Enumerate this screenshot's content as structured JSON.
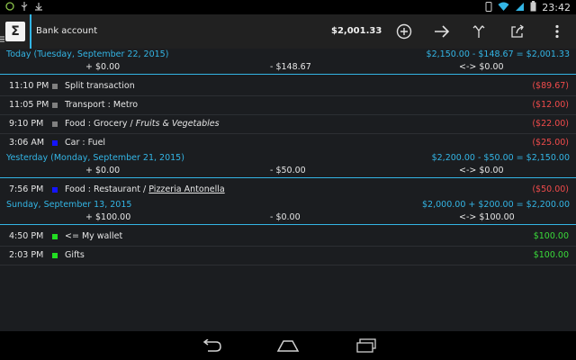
{
  "status_bar": {
    "time": "23:42",
    "left_icons": [
      "android-debug-icon",
      "usb-icon",
      "download-icon"
    ],
    "right_icons": [
      "vibrate-icon",
      "wifi-icon",
      "signal-icon",
      "battery-icon"
    ]
  },
  "action_bar": {
    "account_name": "Bank account",
    "balance": "$2,001.33",
    "actions": [
      "add-icon",
      "transfer-icon",
      "split-icon",
      "share-icon",
      "overflow-menu-icon"
    ],
    "accent_color": "#33b5e5"
  },
  "groups": [
    {
      "date": "Today (Tuesday, September 22, 2015)",
      "calc": "$2,150.00 - $148.67 = $2,001.33",
      "income": "+ $0.00",
      "expense": "- $148.67",
      "transfer": "<-> $0.00",
      "transactions": [
        {
          "time": "11:10 PM",
          "color": "#808080",
          "category": "Split transaction",
          "sub": "",
          "payee": "",
          "amount": "($89.67)",
          "amount_color": "#f24b4b"
        },
        {
          "time": "11:05 PM",
          "color": "#808080",
          "category": "Transport : Metro",
          "sub": "",
          "payee": "",
          "amount": "($12.00)",
          "amount_color": "#f24b4b"
        },
        {
          "time": "9:10 PM",
          "color": "#808080",
          "category": "Food : Grocery / ",
          "sub": "Fruits & Vegetables",
          "payee": "",
          "amount": "($22.00)",
          "amount_color": "#f24b4b"
        },
        {
          "time": "3:06 AM",
          "color": "#1414ff",
          "category": "Car : Fuel",
          "sub": "",
          "payee": "",
          "amount": "($25.00)",
          "amount_color": "#f24b4b"
        }
      ]
    },
    {
      "date": "Yesterday (Monday, September 21, 2015)",
      "calc": "$2,200.00 - $50.00 = $2,150.00",
      "income": "+ $0.00",
      "expense": "- $50.00",
      "transfer": "<-> $0.00",
      "transactions": [
        {
          "time": "7:56 PM",
          "color": "#1414ff",
          "category": "Food : Restaurant / ",
          "sub": "",
          "payee": "Pizzeria Antonella",
          "amount": "($50.00)",
          "amount_color": "#f24b4b"
        }
      ]
    },
    {
      "date": "Sunday, September 13, 2015",
      "calc": "$2,000.00 + $200.00 = $2,200.00",
      "income": "+ $100.00",
      "expense": "- $0.00",
      "transfer": "<-> $100.00",
      "transactions": [
        {
          "time": "4:50 PM",
          "color": "#22dd22",
          "category": "<= My wallet",
          "sub": "",
          "payee": "",
          "amount": "$100.00",
          "amount_color": "#3adb3a"
        },
        {
          "time": "2:03 PM",
          "color": "#22dd22",
          "category": "Gifts",
          "sub": "",
          "payee": "",
          "amount": "$100.00",
          "amount_color": "#3adb3a"
        }
      ]
    }
  ],
  "nav_bar": {
    "buttons": [
      "back-icon",
      "home-icon",
      "recent-apps-icon"
    ]
  }
}
